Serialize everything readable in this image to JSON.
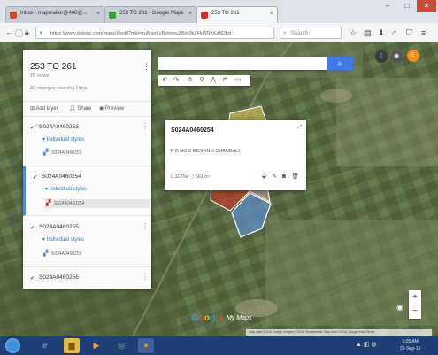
{
  "browser": {
    "tabs": [
      {
        "label": "Inbox - mapmaker@468@...",
        "icon_color": "#d14836"
      },
      {
        "label": "253 TO 261 - Google Maps",
        "icon_color": "#3d9c3d"
      },
      {
        "label": "253 TO 261",
        "icon_color": "#d93025"
      }
    ],
    "url": "https://www.google.com/maps/d/edit?mid=zuMxe6uBehwsvZBm0kZFkWRzKaBDhd",
    "search_placeholder": "Search",
    "nav_icons": [
      "back-icon",
      "forward-icon",
      "refresh-icon"
    ],
    "toolbar_icons": [
      "star-icon",
      "reading-icon",
      "download-icon",
      "home-icon",
      "shield-icon",
      "menu-icon"
    ]
  },
  "panel": {
    "title": "253 TO 261",
    "views": "75 views",
    "saved": "All changes saved in Drive",
    "actions": {
      "add_layer": "Add layer",
      "share": "Share",
      "preview": "Preview"
    },
    "layers": [
      {
        "name": "S024A0460253",
        "style": "Individual styles",
        "item": "S024A0460253",
        "selected": false,
        "highlight": false,
        "item_color": "#4a8fe0"
      },
      {
        "name": "S024A0460254",
        "style": "Individual styles",
        "item": "S024A0460254",
        "selected": true,
        "highlight": true,
        "item_color": "#c0392b"
      },
      {
        "name": "S024A0460255",
        "style": "Individual styles",
        "item": "S024A0460255",
        "selected": false,
        "highlight": false,
        "item_color": "#4a8fe0"
      },
      {
        "name": "S024A0460256",
        "style": "",
        "item": "",
        "selected": false,
        "highlight": false,
        "item_color": "#4a8fe0"
      }
    ]
  },
  "popup": {
    "title": "S024A0460254",
    "address": "P B NO 2 ROSHNO CHAUBALI",
    "measure": "0.117ha  ⬚ 561 m"
  },
  "map": {
    "logo": "Google",
    "mymaps": "My Maps",
    "attribution": "Map data ©2016 Google Imagery ©2016 TerraMetrics, Map data ©2016 Google  India  Terms",
    "zoom_in": "+",
    "zoom_out": "−"
  },
  "taskbar": {
    "clock_time": "5:05 AM",
    "clock_date": "26-Sep-16"
  },
  "colors": {
    "accent_blue": "#3d7be6",
    "taskbar": "#1c3f76",
    "parcel_yellow": "#e7cf5c",
    "parcel_red": "#c0392b",
    "parcel_blue": "#5b8fd0"
  }
}
